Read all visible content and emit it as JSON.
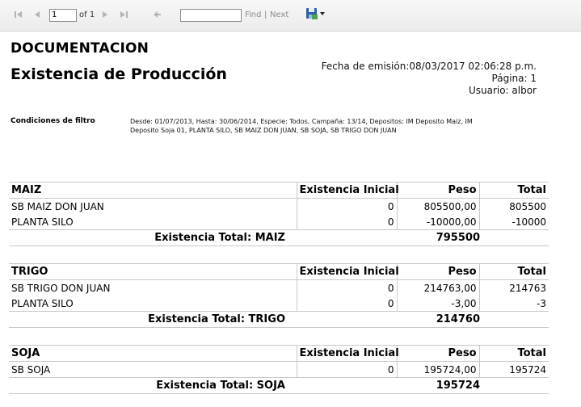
{
  "toolbar": {
    "icons": [
      "first-page-icon",
      "previous-page-icon",
      "next-page-icon",
      "last-page-icon",
      "back-icon",
      "save-export-icon"
    ],
    "page_value": "1",
    "of_text": "of 1",
    "find_value": "",
    "find_label": "Find",
    "separator": "|",
    "next_label": "Next"
  },
  "report": {
    "title": "DOCUMENTACION",
    "subtitle": "Existencia de Producción",
    "emission": "Fecha de emisión:08/03/2017 02:06:28 p.m.",
    "page": "Página: 1",
    "user": "Usuario: albor",
    "filter_label": "Condiciones de filtro",
    "filter_text": "Desde: 01/07/2013, Hasta: 30/06/2014, Especie: Todos, Campaña: 13/14, Depositos: IM Deposito Maiz, IM Deposito Soja 01, PLANTA SILO, SB MAIZ DON JUAN, SB SOJA, SB TRIGO DON JUAN"
  },
  "columns": {
    "inicial": "Existencia Inicial",
    "peso": "Peso",
    "total": "Total"
  },
  "sections": [
    {
      "name": "MAIZ",
      "rows": [
        {
          "deposito": "SB MAIZ DON JUAN",
          "inicial": "0",
          "peso": "805500,00",
          "total": "805500"
        },
        {
          "deposito": "PLANTA SILO",
          "inicial": "0",
          "peso": "-10000,00",
          "total": "-10000"
        }
      ],
      "total_label": "Existencia Total: MAIZ",
      "total_value": "795500"
    },
    {
      "name": "TRIGO",
      "rows": [
        {
          "deposito": "SB TRIGO DON JUAN",
          "inicial": "0",
          "peso": "214763,00",
          "total": "214763"
        },
        {
          "deposito": "PLANTA SILO",
          "inicial": "0",
          "peso": "-3,00",
          "total": "-3"
        }
      ],
      "total_label": "Existencia Total: TRIGO",
      "total_value": "214760"
    },
    {
      "name": "SOJA",
      "rows": [
        {
          "deposito": "SB SOJA",
          "inicial": "0",
          "peso": "195724,00",
          "total": "195724"
        }
      ],
      "total_label": "Existencia Total: SOJA",
      "total_value": "195724"
    }
  ]
}
